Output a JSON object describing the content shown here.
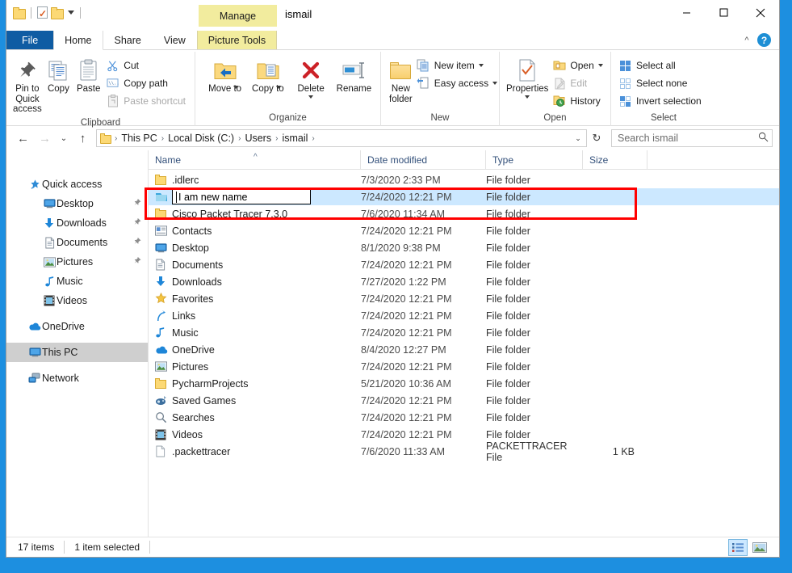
{
  "window": {
    "title": "ismail",
    "minimize_label": "Minimize",
    "maximize_label": "Maximize",
    "close_label": "Close",
    "help_label": "?",
    "collapse_ribbon_label": "^"
  },
  "quick_access_toolbar": {
    "items": [
      {
        "name": "new-folder-icon",
        "label": ""
      },
      {
        "name": "properties-icon",
        "label": ""
      },
      {
        "name": "folder-icon",
        "label": ""
      },
      {
        "name": "customize-dropdown-icon",
        "label": ""
      }
    ]
  },
  "contextual_tab_group": {
    "title": "Manage",
    "tab_label": "Picture Tools"
  },
  "tabs": [
    {
      "id": "file",
      "label": "File"
    },
    {
      "id": "home",
      "label": "Home"
    },
    {
      "id": "share",
      "label": "Share"
    },
    {
      "id": "view",
      "label": "View"
    },
    {
      "id": "picture-tools",
      "label": "Picture Tools"
    }
  ],
  "active_tab": "Home",
  "ribbon": {
    "groups": [
      {
        "name": "Clipboard",
        "label": "Clipboard",
        "big_buttons": [
          {
            "label": "Pin to Quick access",
            "icon": "pin-icon",
            "disabled": false
          },
          {
            "label": "Copy",
            "icon": "copy-icon",
            "disabled": false
          },
          {
            "label": "Paste",
            "icon": "paste-icon",
            "disabled": false
          }
        ],
        "small_buttons": [
          {
            "label": "Cut",
            "icon": "scissors-icon",
            "disabled": false
          },
          {
            "label": "Copy path",
            "icon": "copy-path-icon",
            "disabled": false
          },
          {
            "label": "Paste shortcut",
            "icon": "paste-shortcut-icon",
            "disabled": true
          }
        ]
      },
      {
        "name": "Organize",
        "label": "Organize",
        "big_buttons": [
          {
            "label": "Move to",
            "icon": "move-to-icon",
            "has_caret": true
          },
          {
            "label": "Copy to",
            "icon": "copy-to-icon",
            "has_caret": true
          },
          {
            "label": "Delete",
            "icon": "delete-icon",
            "has_caret": true
          },
          {
            "label": "Rename",
            "icon": "rename-icon",
            "has_caret": false
          }
        ]
      },
      {
        "name": "New",
        "label": "New",
        "big_buttons": [
          {
            "label": "New folder",
            "icon": "new-folder-icon"
          }
        ],
        "small_buttons": [
          {
            "label": "New item",
            "icon": "new-item-icon",
            "has_caret": true
          },
          {
            "label": "Easy access",
            "icon": "easy-access-icon",
            "has_caret": true
          }
        ]
      },
      {
        "name": "Open",
        "label": "Open",
        "big_buttons": [
          {
            "label": "Properties",
            "icon": "properties-icon",
            "has_caret": true
          }
        ],
        "small_buttons": [
          {
            "label": "Open",
            "icon": "open-icon",
            "has_caret": true,
            "disabled": false
          },
          {
            "label": "Edit",
            "icon": "edit-icon",
            "disabled": true
          },
          {
            "label": "History",
            "icon": "history-icon",
            "disabled": false
          }
        ]
      },
      {
        "name": "Select",
        "label": "Select",
        "small_buttons": [
          {
            "label": "Select all",
            "icon": "select-all-icon"
          },
          {
            "label": "Select none",
            "icon": "select-none-icon"
          },
          {
            "label": "Invert selection",
            "icon": "invert-selection-icon"
          }
        ]
      }
    ]
  },
  "address_bar": {
    "back_label": "←",
    "forward_label": "→",
    "recent_label": "⌄",
    "up_label": "↑",
    "breadcrumbs": [
      "This PC",
      "Local Disk (C:)",
      "Users",
      "ismail"
    ],
    "separator": "›",
    "dropdown_label": "⌄",
    "refresh_label": "↻"
  },
  "search": {
    "placeholder": "Search ismail",
    "value": "",
    "icon": "search-icon"
  },
  "nav_pane": {
    "items": [
      {
        "label": "Quick access",
        "icon": "quick-access-star-icon",
        "indent": 0,
        "pinned": false,
        "selected": false
      },
      {
        "label": "Desktop",
        "icon": "desktop-icon",
        "indent": 1,
        "pinned": true,
        "selected": false
      },
      {
        "label": "Downloads",
        "icon": "downloads-icon",
        "indent": 1,
        "pinned": true,
        "selected": false
      },
      {
        "label": "Documents",
        "icon": "documents-icon",
        "indent": 1,
        "pinned": true,
        "selected": false
      },
      {
        "label": "Pictures",
        "icon": "pictures-icon",
        "indent": 1,
        "pinned": true,
        "selected": false
      },
      {
        "label": "Music",
        "icon": "music-icon",
        "indent": 1,
        "pinned": false,
        "selected": false
      },
      {
        "label": "Videos",
        "icon": "videos-icon",
        "indent": 1,
        "pinned": false,
        "selected": false
      },
      {
        "label": "OneDrive",
        "icon": "onedrive-cloud-icon",
        "indent": 0,
        "pinned": false,
        "selected": false
      },
      {
        "label": "This PC",
        "icon": "this-pc-icon",
        "indent": 0,
        "pinned": false,
        "selected": true
      },
      {
        "label": "Network",
        "icon": "network-icon",
        "indent": 0,
        "pinned": false,
        "selected": false
      }
    ]
  },
  "file_list": {
    "columns": [
      {
        "key": "name",
        "label": "Name",
        "sorted": true,
        "sort_dir": "asc"
      },
      {
        "key": "date",
        "label": "Date modified"
      },
      {
        "key": "type",
        "label": "Type"
      },
      {
        "key": "size",
        "label": "Size"
      }
    ],
    "rows": [
      {
        "name": ".idlerc",
        "date": "7/3/2020 2:33 PM",
        "type": "File folder",
        "size": "",
        "icon": "folder-icon",
        "selected": false,
        "editing": false
      },
      {
        "name": "I am new name",
        "date": "7/24/2020 12:21 PM",
        "type": "File folder",
        "size": "",
        "icon": "blue-folder-icon",
        "selected": true,
        "editing": true
      },
      {
        "name": "Cisco Packet Tracer 7.3.0",
        "date": "7/6/2020 11:34 AM",
        "type": "File folder",
        "size": "",
        "icon": "folder-icon",
        "selected": false,
        "editing": false
      },
      {
        "name": "Contacts",
        "date": "7/24/2020 12:21 PM",
        "type": "File folder",
        "size": "",
        "icon": "contacts-icon",
        "selected": false,
        "editing": false
      },
      {
        "name": "Desktop",
        "date": "8/1/2020 9:38 PM",
        "type": "File folder",
        "size": "",
        "icon": "desktop-icon",
        "selected": false,
        "editing": false
      },
      {
        "name": "Documents",
        "date": "7/24/2020 12:21 PM",
        "type": "File folder",
        "size": "",
        "icon": "documents-icon",
        "selected": false,
        "editing": false
      },
      {
        "name": "Downloads",
        "date": "7/27/2020 1:22 PM",
        "type": "File folder",
        "size": "",
        "icon": "downloads-icon",
        "selected": false,
        "editing": false
      },
      {
        "name": "Favorites",
        "date": "7/24/2020 12:21 PM",
        "type": "File folder",
        "size": "",
        "icon": "favorites-star-icon",
        "selected": false,
        "editing": false
      },
      {
        "name": "Links",
        "date": "7/24/2020 12:21 PM",
        "type": "File folder",
        "size": "",
        "icon": "links-icon",
        "selected": false,
        "editing": false
      },
      {
        "name": "Music",
        "date": "7/24/2020 12:21 PM",
        "type": "File folder",
        "size": "",
        "icon": "music-icon",
        "selected": false,
        "editing": false
      },
      {
        "name": "OneDrive",
        "date": "8/4/2020 12:27 PM",
        "type": "File folder",
        "size": "",
        "icon": "onedrive-cloud-icon",
        "selected": false,
        "editing": false
      },
      {
        "name": "Pictures",
        "date": "7/24/2020 12:21 PM",
        "type": "File folder",
        "size": "",
        "icon": "pictures-icon",
        "selected": false,
        "editing": false
      },
      {
        "name": "PycharmProjects",
        "date": "5/21/2020 10:36 AM",
        "type": "File folder",
        "size": "",
        "icon": "folder-icon",
        "selected": false,
        "editing": false
      },
      {
        "name": "Saved Games",
        "date": "7/24/2020 12:21 PM",
        "type": "File folder",
        "size": "",
        "icon": "saved-games-icon",
        "selected": false,
        "editing": false
      },
      {
        "name": "Searches",
        "date": "7/24/2020 12:21 PM",
        "type": "File folder",
        "size": "",
        "icon": "searches-magnifier-icon",
        "selected": false,
        "editing": false
      },
      {
        "name": "Videos",
        "date": "7/24/2020 12:21 PM",
        "type": "File folder",
        "size": "",
        "icon": "videos-icon",
        "selected": false,
        "editing": false
      },
      {
        "name": ".packettracer",
        "date": "7/6/2020 11:33 AM",
        "type": "PACKETTRACER File",
        "size": "1 KB",
        "icon": "generic-file-icon",
        "selected": false,
        "editing": false
      }
    ]
  },
  "rename_edit": {
    "value": "I am new name"
  },
  "status_bar": {
    "item_count": "17 items",
    "selection": "1 item selected",
    "view_details_label": "Details view",
    "view_large_label": "Large icons view"
  },
  "annotation": {
    "color": "#ff0000",
    "target": "rename-edit-row"
  }
}
